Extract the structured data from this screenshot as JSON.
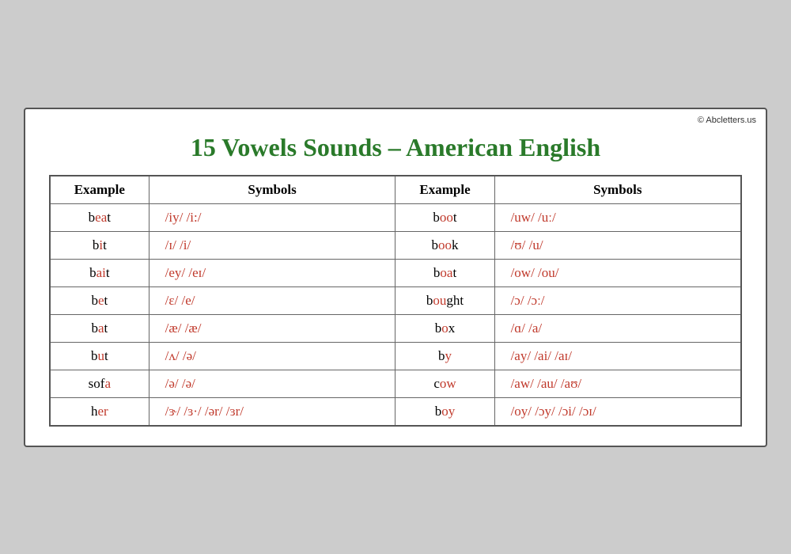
{
  "copyright": "© Abcletters.us",
  "title": "15 Vowels Sounds – American English",
  "headers": {
    "example": "Example",
    "symbols": "Symbols"
  },
  "rows_left": [
    {
      "word_parts": [
        {
          "text": "b",
          "red": false
        },
        {
          "text": "ea",
          "red": true
        },
        {
          "text": "t",
          "red": false
        }
      ],
      "symbols": "/iy/        /i:/"
    },
    {
      "word_parts": [
        {
          "text": "b",
          "red": false
        },
        {
          "text": "i",
          "red": true
        },
        {
          "text": "t",
          "red": false
        }
      ],
      "symbols": "/ɪ/          /i/"
    },
    {
      "word_parts": [
        {
          "text": "b",
          "red": false
        },
        {
          "text": "ai",
          "red": true
        },
        {
          "text": "t",
          "red": false
        }
      ],
      "symbols": "/ey/     /eɪ/"
    },
    {
      "word_parts": [
        {
          "text": "b",
          "red": false
        },
        {
          "text": "e",
          "red": true
        },
        {
          "text": "t",
          "red": false
        }
      ],
      "symbols": "/ɛ/        /e/"
    },
    {
      "word_parts": [
        {
          "text": "b",
          "red": false
        },
        {
          "text": "a",
          "red": true
        },
        {
          "text": "t",
          "red": false
        }
      ],
      "symbols": "/æ/      /æ/"
    },
    {
      "word_parts": [
        {
          "text": "b",
          "red": false
        },
        {
          "text": "u",
          "red": true
        },
        {
          "text": "t",
          "red": false
        }
      ],
      "symbols": "/ʌ/        /ə/"
    },
    {
      "word_parts": [
        {
          "text": "sof",
          "red": false
        },
        {
          "text": "a",
          "red": true
        }
      ],
      "symbols": "/ə/         /ə/"
    },
    {
      "word_parts": [
        {
          "text": "h",
          "red": false
        },
        {
          "text": "er",
          "red": true
        }
      ],
      "symbols": "/ɝ/  /ɜ·/  /ər/   /ɜr/"
    }
  ],
  "rows_right": [
    {
      "word_parts": [
        {
          "text": "b",
          "red": false
        },
        {
          "text": "oo",
          "red": true
        },
        {
          "text": "t",
          "red": false
        }
      ],
      "symbols": "/uw/       /uː/"
    },
    {
      "word_parts": [
        {
          "text": "b",
          "red": false
        },
        {
          "text": "oo",
          "red": true
        },
        {
          "text": "k",
          "red": false
        }
      ],
      "symbols": "/ʊ/          /u/"
    },
    {
      "word_parts": [
        {
          "text": "b",
          "red": false
        },
        {
          "text": "oa",
          "red": true
        },
        {
          "text": "t",
          "red": false
        }
      ],
      "symbols": "/ow/    /ou/"
    },
    {
      "word_parts": [
        {
          "text": "b",
          "red": false
        },
        {
          "text": "ou",
          "red": true
        },
        {
          "text": "ght",
          "red": false
        }
      ],
      "symbols": "/ɔ/          /ɔː/"
    },
    {
      "word_parts": [
        {
          "text": "b",
          "red": false
        },
        {
          "text": "o",
          "red": true
        },
        {
          "text": "x",
          "red": false
        }
      ],
      "symbols": "/ɑ/          /a/"
    },
    {
      "word_parts": [
        {
          "text": "b",
          "red": false
        },
        {
          "text": "y",
          "red": true
        }
      ],
      "symbols": "/ay/   /ai/   /aɪ/"
    },
    {
      "word_parts": [
        {
          "text": "c",
          "red": false
        },
        {
          "text": "ow",
          "red": true
        }
      ],
      "symbols": "/aw/   /au/   /aʊ/"
    },
    {
      "word_parts": [
        {
          "text": "b",
          "red": false
        },
        {
          "text": "oy",
          "red": true
        }
      ],
      "symbols": "/oy/   /ɔy/   /ɔi/   /ɔɪ/"
    }
  ]
}
